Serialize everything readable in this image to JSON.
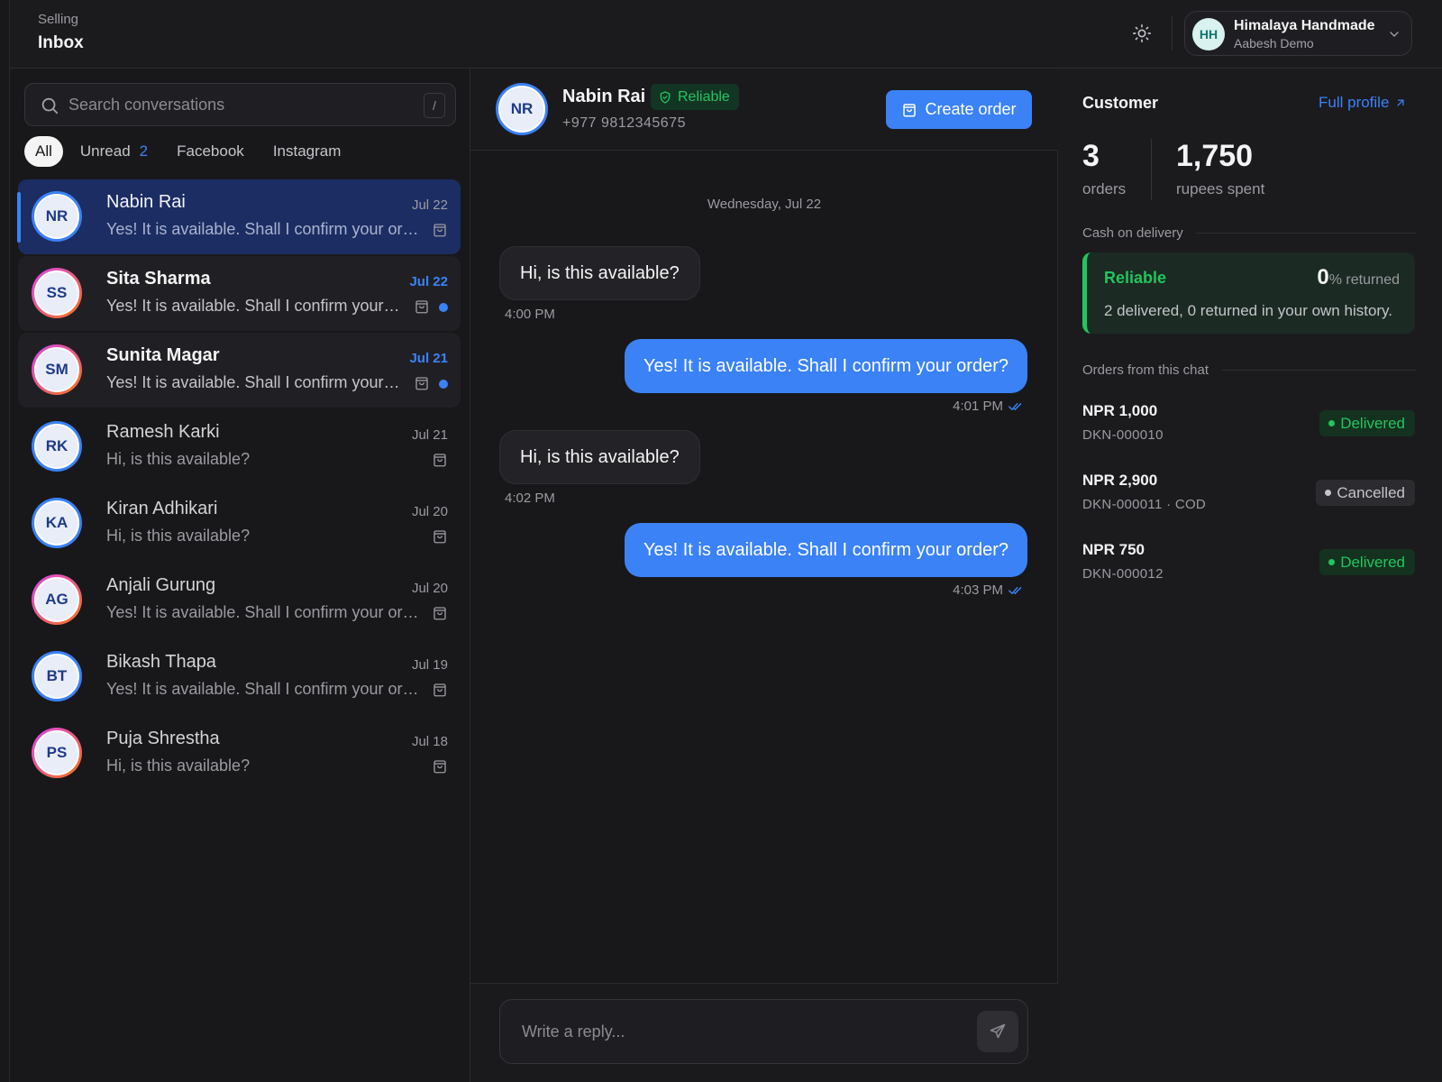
{
  "header": {
    "section": "Selling",
    "title": "Inbox",
    "account": {
      "initials": "HH",
      "name": "Himalaya Handmade",
      "subtitle": "Aabesh Demo"
    }
  },
  "inbox": {
    "search_placeholder": "Search conversations",
    "search_shortcut": "/",
    "filters": [
      {
        "label": "All",
        "count": "",
        "active": true
      },
      {
        "label": "Unread",
        "count": "2",
        "active": false
      },
      {
        "label": "Facebook",
        "count": "",
        "active": false
      },
      {
        "label": "Instagram",
        "count": "",
        "active": false
      }
    ],
    "conversations": [
      {
        "initials": "NR",
        "name": "Nabin Rai",
        "date": "Jul 22",
        "preview": "Yes! It is available. Shall I confirm your order?",
        "state": "selected",
        "ring": "blue"
      },
      {
        "initials": "SS",
        "name": "Sita Sharma",
        "date": "Jul 22",
        "preview": "Yes! It is available. Shall I confirm your order?",
        "state": "unread",
        "ring": "gradient"
      },
      {
        "initials": "SM",
        "name": "Sunita Magar",
        "date": "Jul 21",
        "preview": "Yes! It is available. Shall I confirm your order?",
        "state": "unread",
        "ring": "gradient"
      },
      {
        "initials": "RK",
        "name": "Ramesh Karki",
        "date": "Jul 21",
        "preview": "Hi, is this available?",
        "state": "read",
        "ring": "blue"
      },
      {
        "initials": "KA",
        "name": "Kiran Adhikari",
        "date": "Jul 20",
        "preview": "Hi, is this available?",
        "state": "read",
        "ring": "blue"
      },
      {
        "initials": "AG",
        "name": "Anjali Gurung",
        "date": "Jul 20",
        "preview": "Yes! It is available. Shall I confirm your order?",
        "state": "read",
        "ring": "gradient"
      },
      {
        "initials": "BT",
        "name": "Bikash Thapa",
        "date": "Jul 19",
        "preview": "Yes! It is available. Shall I confirm your order?",
        "state": "read",
        "ring": "blue"
      },
      {
        "initials": "PS",
        "name": "Puja Shrestha",
        "date": "Jul 18",
        "preview": "Hi, is this available?",
        "state": "read",
        "ring": "gradient"
      }
    ]
  },
  "chat": {
    "contact": {
      "initials": "NR",
      "name": "Nabin Rai",
      "badge": "Reliable",
      "phone": "+977 9812345675"
    },
    "create_order_label": "Create order",
    "day_separator": "Wednesday, Jul 22",
    "messages": [
      {
        "direction": "in",
        "text": "Hi, is this available?",
        "time": "4:00 PM"
      },
      {
        "direction": "out",
        "text": "Yes! It is available. Shall I confirm your order?",
        "time": "4:01 PM"
      },
      {
        "direction": "in",
        "text": "Hi, is this available?",
        "time": "4:02 PM"
      },
      {
        "direction": "out",
        "text": "Yes! It is available. Shall I confirm your order?",
        "time": "4:03 PM"
      }
    ],
    "composer_placeholder": "Write a reply..."
  },
  "customer": {
    "title": "Customer",
    "full_profile_label": "Full profile",
    "stats": [
      {
        "value": "3",
        "label": "orders"
      },
      {
        "value": "1,750",
        "label": "rupees spent"
      }
    ],
    "cod": {
      "section_label": "Cash on delivery",
      "status": "Reliable",
      "returned_pct": "0",
      "returned_suffix": "% returned",
      "history": "2 delivered, 0 returned in your own history."
    },
    "orders_label": "Orders from this chat",
    "orders": [
      {
        "amount": "NPR 1,000",
        "ref": "DKN-000010",
        "status": "Delivered"
      },
      {
        "amount": "NPR 2,900",
        "ref": "DKN-000011 · COD",
        "status": "Cancelled"
      },
      {
        "amount": "NPR 750",
        "ref": "DKN-000012",
        "status": "Delivered"
      }
    ]
  },
  "colors": {
    "accent": "#3b82f6",
    "success": "#22c55e",
    "selected_row": "#1c2d63",
    "background": "#18181b"
  }
}
